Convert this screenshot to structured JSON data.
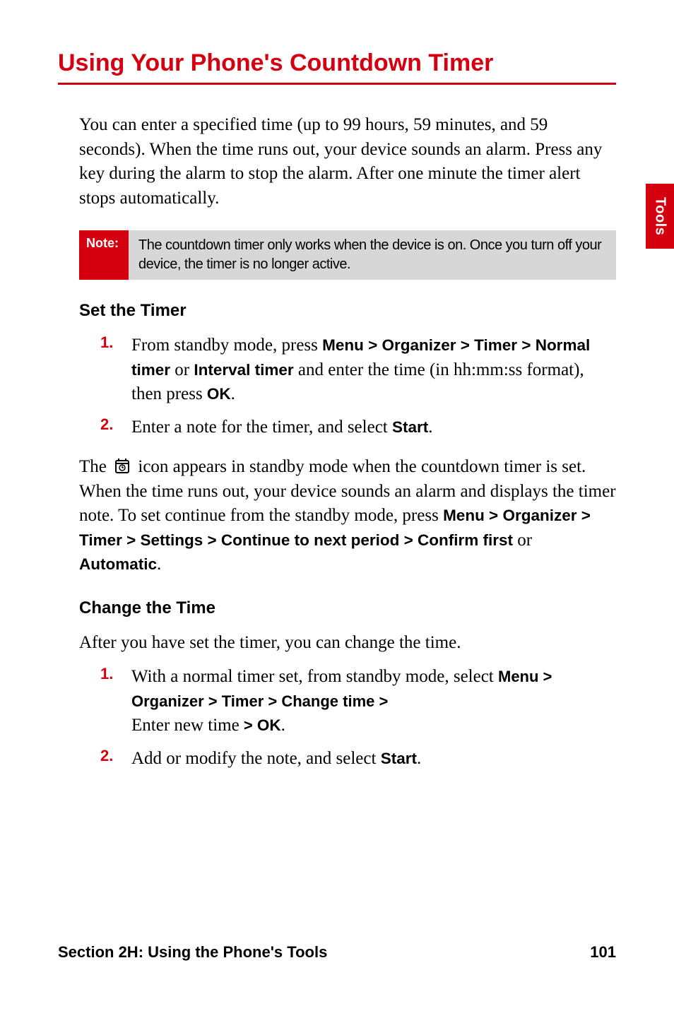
{
  "side_tab": "Tools",
  "title": "Using Your Phone's Countdown Timer",
  "intro": "You can enter a specified time (up to 99 hours, 59 minutes, and 59 seconds). When the time runs out, your device sounds an alarm. Press any key during the alarm to stop the alarm. After one minute the timer alert stops automatically.",
  "note": {
    "label": "Note:",
    "text": "The countdown timer only works when the device is on. Once you turn off your device, the timer is no longer active."
  },
  "section1": {
    "heading": "Set the Timer",
    "step1": {
      "num": "1.",
      "a": "From standby mode, press ",
      "path1": "Menu > Organizer > Timer > Normal timer",
      "b": " or ",
      "path2": "Interval timer",
      "c": " and enter the time (in hh:mm:ss format), then press ",
      "ok": "OK",
      "d": "."
    },
    "step2": {
      "num": "2.",
      "a": "Enter a note for the timer, and select ",
      "start": "Start",
      "b": "."
    },
    "para": {
      "a": "The ",
      "b": " icon appears in standby mode when the countdown timer is set. When the time runs out, your device sounds an alarm and displays the timer note. To set continue from the standby mode, press ",
      "path": "Menu > Organizer > Timer > Settings > Continue to next period  > Confirm first",
      "c": " or ",
      "auto": "Automatic",
      "d": "."
    }
  },
  "section2": {
    "heading": "Change the Time",
    "intro": "After you have set the timer, you can change the time.",
    "step1": {
      "num": "1.",
      "a": "With a normal timer set, from standby mode, select ",
      "path": "Menu > Organizer > Timer > Change time > ",
      "b": "Enter new time",
      "ok_sep": " > ",
      "ok": "OK",
      "c": "."
    },
    "step2": {
      "num": "2.",
      "a": "Add or modify the note, and select ",
      "start": "Start",
      "b": "."
    }
  },
  "footer": {
    "left": "Section 2H: Using the Phone's Tools",
    "right": "101"
  }
}
